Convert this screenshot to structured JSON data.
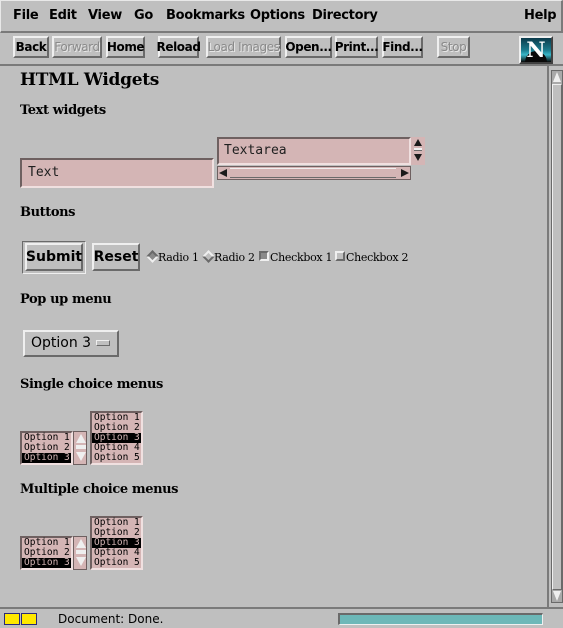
{
  "menubar": {
    "items": [
      "File",
      "Edit",
      "View",
      "Go",
      "Bookmarks",
      "Options",
      "Directory"
    ],
    "help": "Help"
  },
  "toolbar": {
    "buttons": [
      {
        "label": "Back",
        "enabled": true
      },
      {
        "label": "Forward",
        "enabled": false
      },
      {
        "label": "Home",
        "enabled": true
      },
      {
        "label": "Reload",
        "enabled": true
      },
      {
        "label": "Load Images",
        "enabled": false
      },
      {
        "label": "Open...",
        "enabled": true
      },
      {
        "label": "Print...",
        "enabled": true
      },
      {
        "label": "Find...",
        "enabled": true
      },
      {
        "label": "Stop",
        "enabled": false
      }
    ],
    "logo_letter": "N"
  },
  "page": {
    "title": "HTML Widgets",
    "sections": {
      "text_widgets": "Text widgets",
      "buttons": "Buttons",
      "popup_menu": "Pop up menu",
      "single_choice": "Single choice menus",
      "multiple_choice": "Multiple choice menus"
    },
    "text_input": {
      "value": "Text"
    },
    "textarea": {
      "value": "Textarea"
    },
    "submit_label": "Submit",
    "reset_label": "Reset",
    "radios": [
      {
        "label": "Radio 1",
        "selected": true
      },
      {
        "label": "Radio 2",
        "selected": false
      }
    ],
    "checkboxes": [
      {
        "label": "Checkbox 1",
        "checked": true
      },
      {
        "label": "Checkbox 2",
        "checked": false
      }
    ],
    "popup": {
      "selected": "Option 3"
    },
    "single_choice_scrolling": {
      "options": [
        "Option 1",
        "Option 2",
        "Option 3"
      ],
      "selected": "Option 3"
    },
    "single_choice_full": {
      "options": [
        "Option 1",
        "Option 2",
        "Option 3",
        "Option 4",
        "Option 5"
      ],
      "selected": "Option 3"
    },
    "multiple_choice_scrolling": {
      "options": [
        "Option 1",
        "Option 2",
        "Option 3"
      ],
      "selected": [
        "Option 3"
      ]
    },
    "multiple_choice_full": {
      "options": [
        "Option 1",
        "Option 2",
        "Option 3",
        "Option 4",
        "Option 5"
      ],
      "selected": [
        "Option 3"
      ]
    }
  },
  "statusbar": {
    "text": "Document: Done.",
    "progress_percent": 100
  },
  "colors": {
    "chrome": "#bfbfbf",
    "field": "#d4b5b5",
    "progress": "#6cb8b8"
  }
}
